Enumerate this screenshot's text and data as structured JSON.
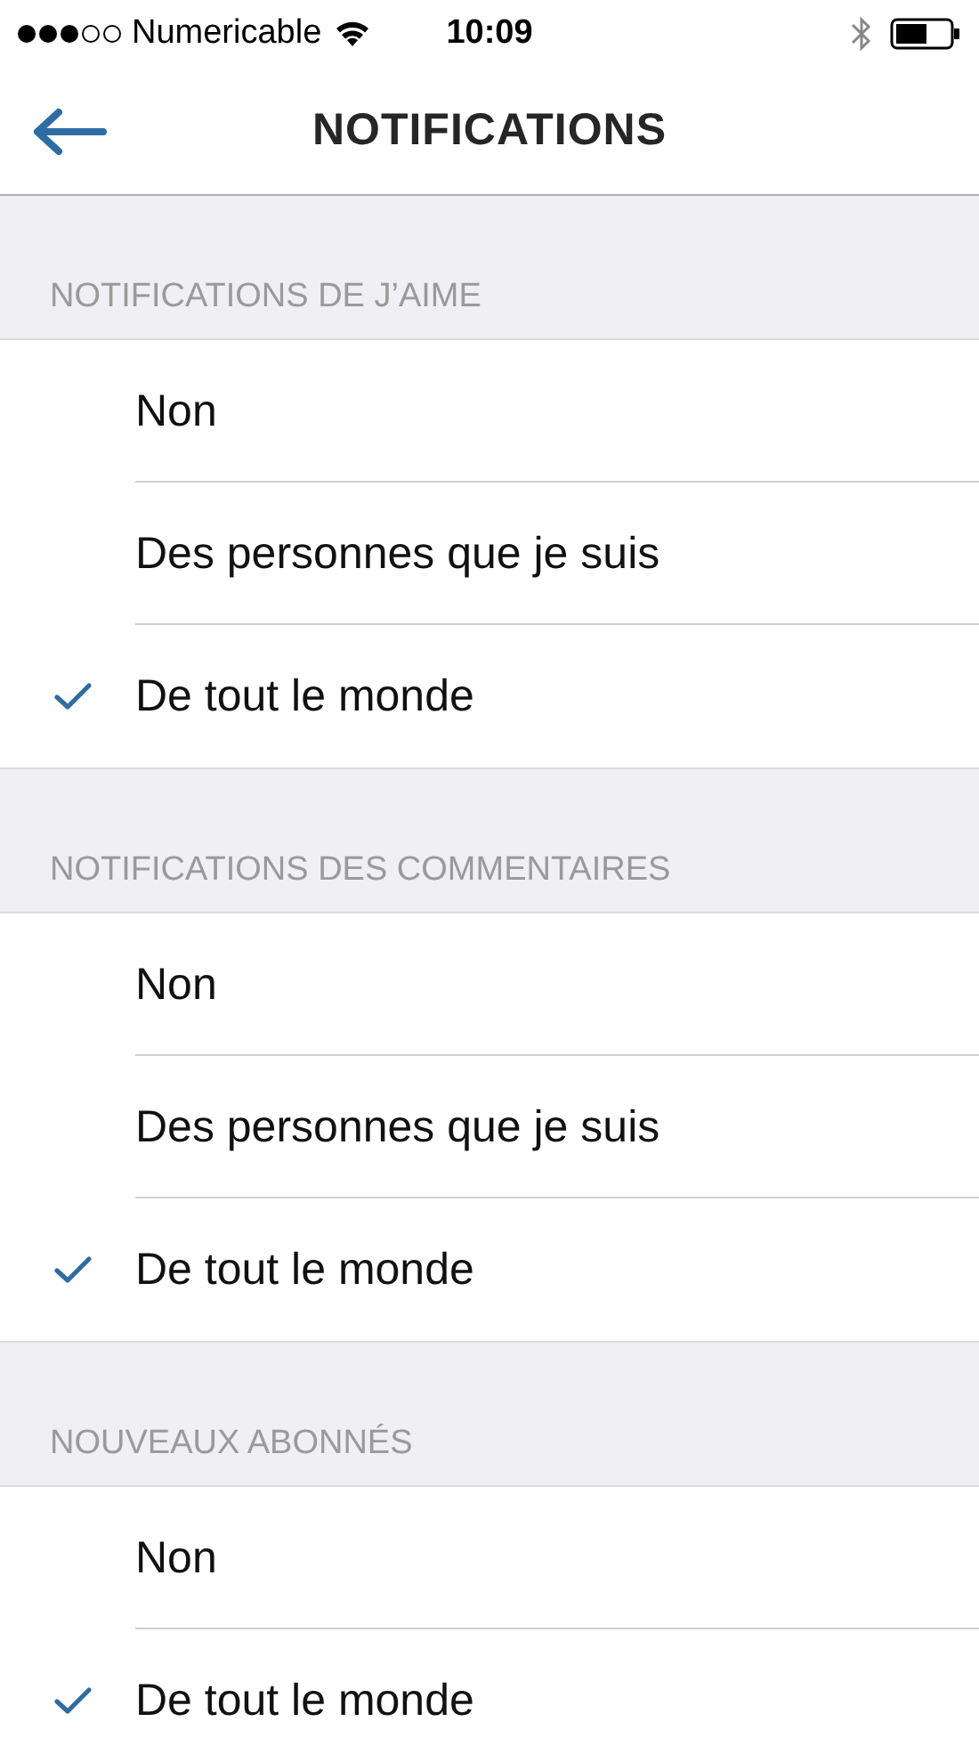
{
  "status_bar": {
    "carrier": "Numericable",
    "time": "10:09"
  },
  "header": {
    "title": "NOTIFICATIONS"
  },
  "sections": [
    {
      "title": "NOTIFICATIONS DE J’AIME",
      "options": [
        {
          "label": "Non",
          "selected": false
        },
        {
          "label": "Des personnes que je suis",
          "selected": false
        },
        {
          "label": "De tout le monde",
          "selected": true
        }
      ]
    },
    {
      "title": "NOTIFICATIONS DES COMMENTAIRES",
      "options": [
        {
          "label": "Non",
          "selected": false
        },
        {
          "label": "Des personnes que je suis",
          "selected": false
        },
        {
          "label": "De tout le monde",
          "selected": true
        }
      ]
    },
    {
      "title": "NOUVEAUX ABONNÉS",
      "options": [
        {
          "label": "Non",
          "selected": false
        },
        {
          "label": "De tout le monde",
          "selected": true
        }
      ]
    }
  ]
}
